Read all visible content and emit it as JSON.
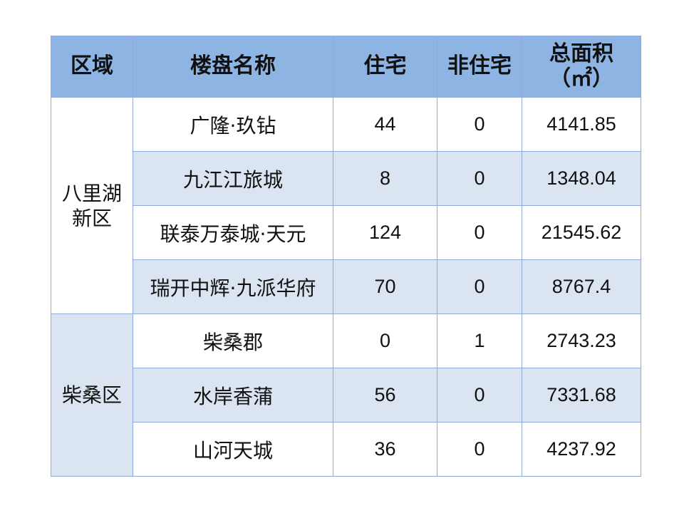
{
  "table": {
    "headers": {
      "district": "区域",
      "project": "楼盘名称",
      "residential": "住宅",
      "non_residential": "非住宅",
      "total_area_line1": "总面积",
      "total_area_line2": "（㎡）"
    },
    "groups": [
      {
        "district_line1": "八里湖",
        "district_line2": "新区",
        "rows": [
          {
            "project": "广隆·玖钻",
            "residential": "44",
            "non_residential": "0",
            "total_area": "4141.85"
          },
          {
            "project": "九江江旅城",
            "residential": "8",
            "non_residential": "0",
            "total_area": "1348.04"
          },
          {
            "project": "联泰万泰城·天元",
            "residential": "124",
            "non_residential": "0",
            "total_area": "21545.62"
          },
          {
            "project": "瑞开中辉·九派华府",
            "residential": "70",
            "non_residential": "0",
            "total_area": "8767.4"
          }
        ]
      },
      {
        "district_line1": "柴桑区",
        "district_line2": "",
        "rows": [
          {
            "project": "柴桑郡",
            "residential": "0",
            "non_residential": "1",
            "total_area": "2743.23"
          },
          {
            "project": "水岸香蒲",
            "residential": "56",
            "non_residential": "0",
            "total_area": "7331.68"
          },
          {
            "project": "山河天城",
            "residential": "36",
            "non_residential": "0",
            "total_area": "4237.92"
          }
        ]
      }
    ]
  }
}
